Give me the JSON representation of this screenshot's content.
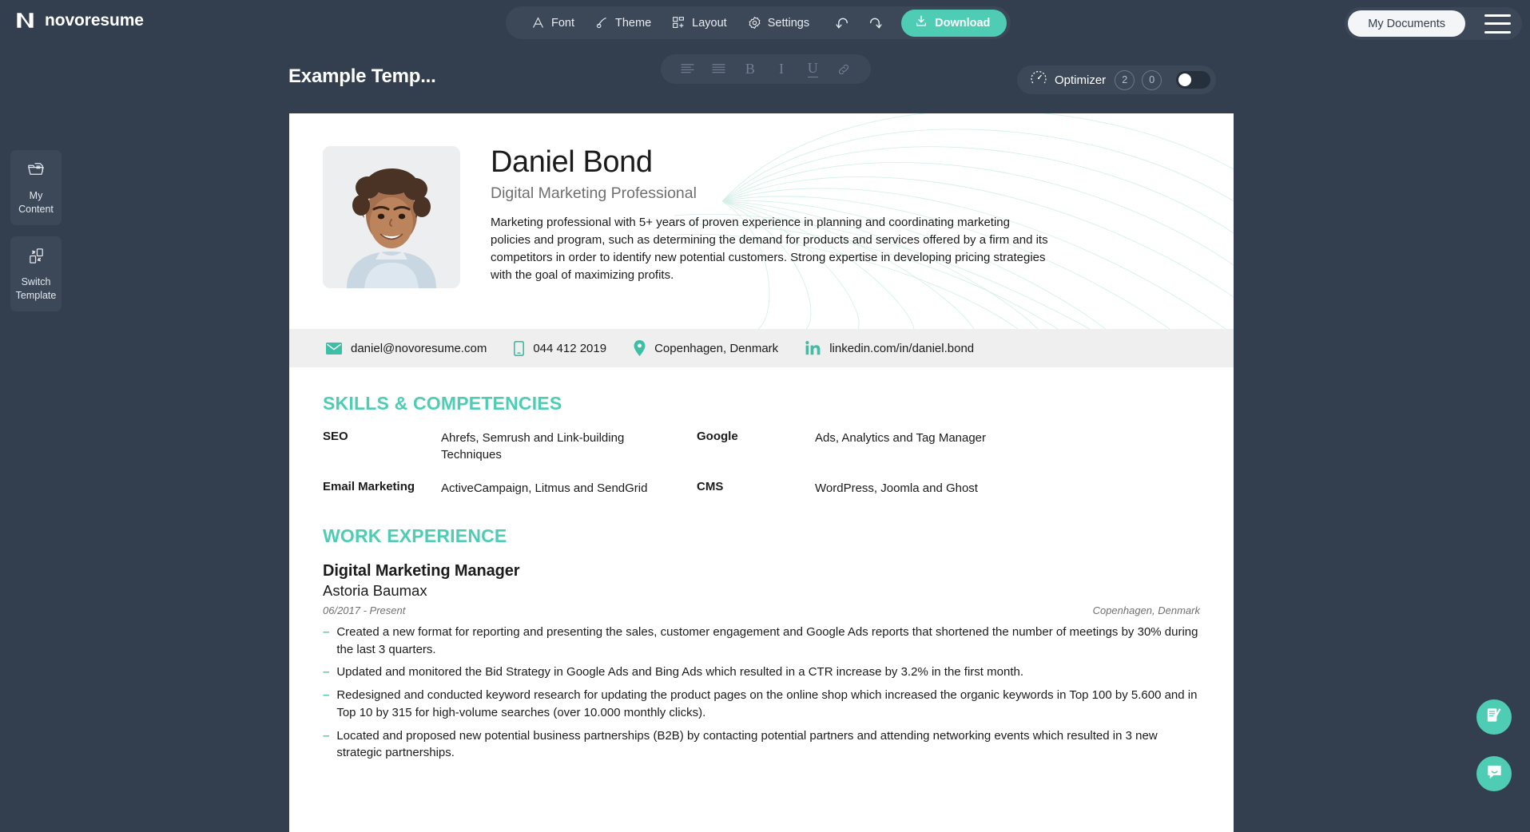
{
  "app": {
    "brand": "novoresume",
    "brand_icon": "novoresume-logo-icon"
  },
  "toolbar": {
    "font_label": "Font",
    "theme_label": "Theme",
    "layout_label": "Layout",
    "settings_label": "Settings",
    "undo_icon": "undo-icon",
    "redo_icon": "redo-icon",
    "download_label": "Download"
  },
  "header_right": {
    "my_documents_label": "My Documents",
    "menu_icon": "hamburger-menu-icon"
  },
  "document": {
    "title": "Example Temp..."
  },
  "format_toolbar": {
    "align_left": "≡",
    "align_justify": "≡",
    "bold": "B",
    "italic": "I",
    "underline": "U",
    "link": "🔗"
  },
  "optimizer": {
    "label": "Optimizer",
    "badge_primary": "2",
    "badge_secondary": "0",
    "toggle_state": "off"
  },
  "rail": {
    "items": [
      {
        "label": "My\nContent",
        "line1": "My",
        "line2": "Content",
        "icon": "folder-content-icon"
      },
      {
        "label": "Switch\nTemplate",
        "line1": "Switch",
        "line2": "Template",
        "icon": "switch-template-icon"
      }
    ]
  },
  "resume": {
    "name": "Daniel Bond",
    "role": "Digital Marketing Professional",
    "summary": "Marketing professional with 5+ years of proven experience in planning and coordinating marketing policies and program, such as determining the demand for products and services offered by a firm and its competitors in order to identify new potential customers. Strong expertise in developing pricing strategies with the goal of maximizing profits.",
    "contact": [
      {
        "icon": "email-icon",
        "value": "daniel@novoresume.com"
      },
      {
        "icon": "phone-icon",
        "value": "044 412 2019"
      },
      {
        "icon": "location-pin-icon",
        "value": "Copenhagen, Denmark"
      },
      {
        "icon": "linkedin-icon",
        "value": "linkedin.com/in/daniel.bond"
      }
    ],
    "skills_section": {
      "title": "SKILLS & COMPETENCIES",
      "items": [
        {
          "key": "SEO",
          "value": "Ahrefs, Semrush and Link-building Techniques"
        },
        {
          "key": "Google",
          "value": "Ads, Analytics and Tag Manager"
        },
        {
          "key": "Email Marketing",
          "value": "ActiveCampaign, Litmus and SendGrid"
        },
        {
          "key": "CMS",
          "value": "WordPress, Joomla and Ghost"
        }
      ]
    },
    "experience_section": {
      "title": "WORK EXPERIENCE",
      "jobs": [
        {
          "title": "Digital Marketing Manager",
          "company": "Astoria Baumax",
          "dates": "06/2017 - Present",
          "location": "Copenhagen, Denmark",
          "bullets": [
            "Created a new format for reporting and presenting the sales, customer engagement and Google Ads reports that shortened the number of meetings by 30% during the last 3 quarters.",
            "Updated and monitored the Bid Strategy in Google Ads and Bing Ads which resulted in a CTR increase by 3.2% in the first month.",
            "Redesigned and conducted keyword research for updating the product pages on the online shop which increased the organic keywords in Top 100 by 5.600 and in Top 10 by 315 for high-volume searches (over 10.000 monthly clicks).",
            "Located and proposed new potential business partnerships (B2B) by contacting potential partners and attending networking events which resulted in 3 new strategic partnerships."
          ]
        }
      ]
    }
  },
  "fabs": [
    {
      "icon": "document-edit-icon"
    },
    {
      "icon": "chat-bubble-icon"
    }
  ],
  "colors": {
    "background": "#333e4f",
    "panel": "#3c4858",
    "accent": "#4ecdb4",
    "page": "#ffffff",
    "contact_bar": "#efefef"
  }
}
